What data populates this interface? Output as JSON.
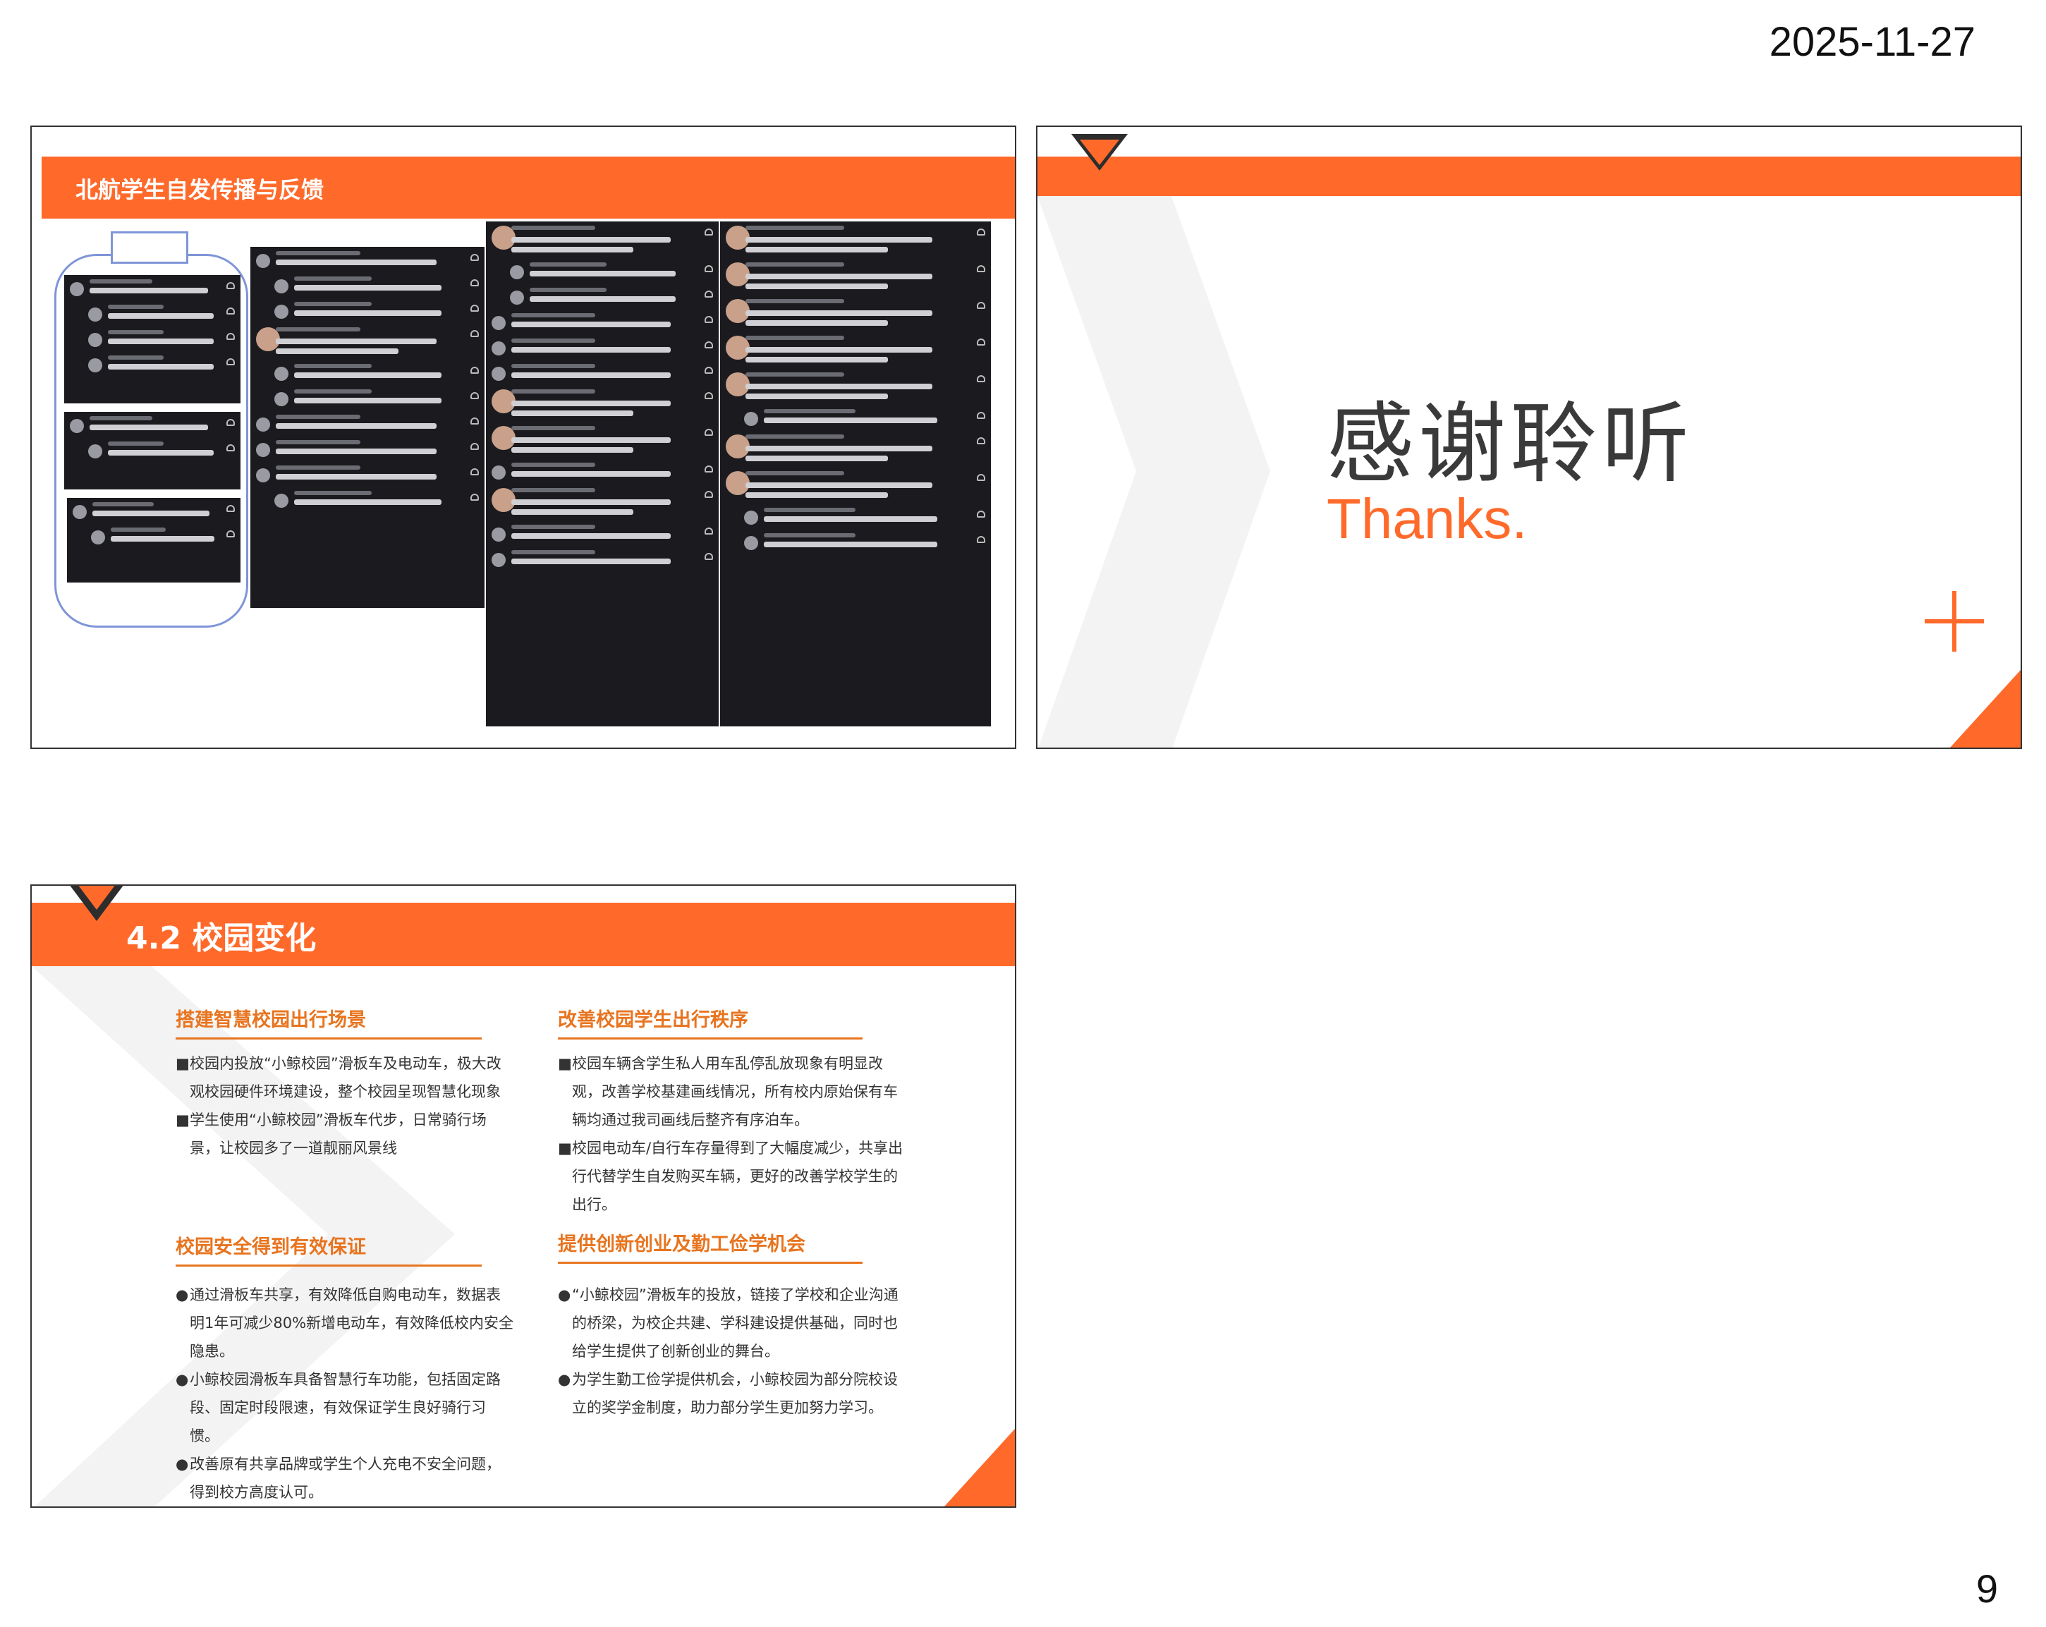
{
  "page": {
    "date": "2025-11-27",
    "number": "9"
  },
  "slide1": {
    "title": "北航学生自发传播与反馈"
  },
  "slide2": {
    "title_cn": "感谢聆听",
    "title_en": "Thanks."
  },
  "slide3": {
    "title": "4.2 校园变化",
    "sections": [
      {
        "heading": "搭建智慧校园出行场景",
        "marker": "■",
        "bullets": [
          "校园内投放“小鲸校园”滑板车及电动车，极大改观校园硬件环境建设，整个校园呈现智慧化现象",
          "学生使用“小鲸校园”滑板车代步，日常骑行场景，让校园多了一道靓丽风景线"
        ]
      },
      {
        "heading": "改善校园学生出行秩序",
        "marker": "■",
        "bullets": [
          "校园车辆含学生私人用车乱停乱放现象有明显改观，改善学校基建画线情况，所有校内原始保有车辆均通过我司画线后整齐有序泊车。",
          "校园电动车/自行车存量得到了大幅度减少，共享出行代替学生自发购买车辆，更好的改善学校学生的出行。"
        ]
      },
      {
        "heading": "校园安全得到有效保证",
        "marker": "●",
        "bullets": [
          "通过滑板车共享，有效降低自购电动车，数据表明1年可减少80%新增电动车，有效降低校内安全隐患。",
          "小鲸校园滑板车具备智慧行车功能，包括固定路段、固定时段限速，有效保证学生良好骑行习惯。",
          "改善原有共享品牌或学生个人充电不安全问题，得到校方高度认可。"
        ]
      },
      {
        "heading": "提供创新创业及勤工俭学机会",
        "marker": "●",
        "bullets": [
          "“小鲸校园”滑板车的投放，链接了学校和企业沟通的桥梁，为校企共建、学科建设提供基础，同时也给学生提供了创新创业的舞台。",
          "为学生勤工俭学提供机会，小鲸校园为部分院校设立的奖学金制度，助力部分学生更加努力学习。"
        ]
      }
    ]
  }
}
